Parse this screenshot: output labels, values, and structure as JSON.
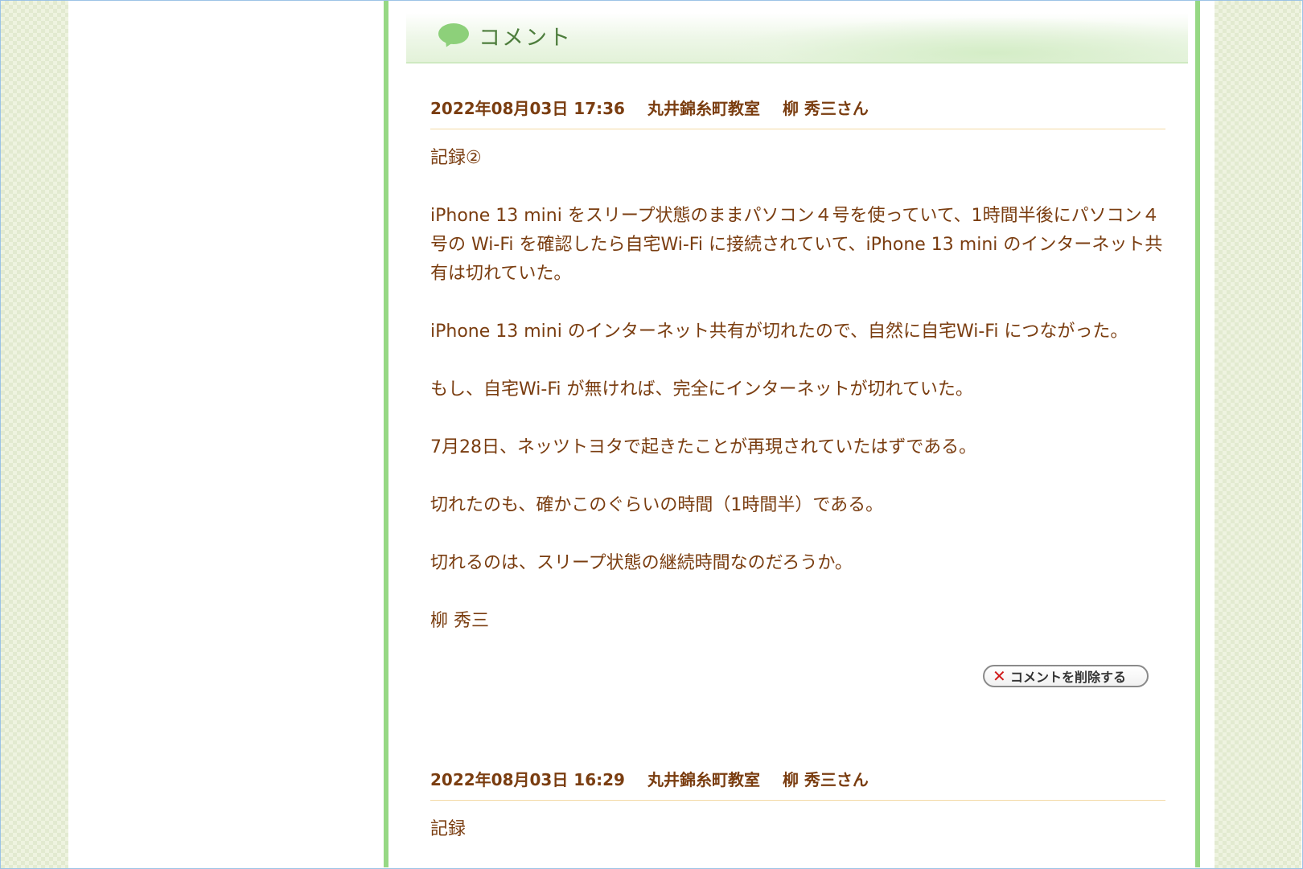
{
  "section": {
    "title": "コメント",
    "icon": "speech-bubble-icon"
  },
  "comments": [
    {
      "date": "2022年08月03日 17:36",
      "classroom": "丸井錦糸町教室",
      "author": "柳 秀三さん",
      "paragraphs": [
        "記録②",
        "iPhone 13 mini をスリープ状態のままパソコン４号を使っていて、1時間半後にパソコン４号の Wi-Fi を確認したら自宅Wi-Fi に接続されていて、iPhone 13 mini のインターネット共有は切れていた。",
        "iPhone 13 mini のインターネット共有が切れたので、自然に自宅Wi-Fi につながった。",
        "もし、自宅Wi-Fi が無ければ、完全にインターネットが切れていた。",
        "7月28日、ネッツトヨタで起きたことが再現されていたはずである。",
        "切れたのも、確かこのぐらいの時間（1時間半）である。",
        "切れるのは、スリープ状態の継続時間なのだろうか。",
        "柳 秀三"
      ],
      "delete_label": "コメントを削除する"
    },
    {
      "date": "2022年08月03日 16:29",
      "classroom": "丸井錦糸町教室",
      "author": "柳 秀三さん",
      "paragraphs": [
        "記録"
      ]
    }
  ],
  "colors": {
    "accent_green": "#96d884",
    "text_brown": "#7a3d10",
    "delete_x": "#d01818"
  }
}
